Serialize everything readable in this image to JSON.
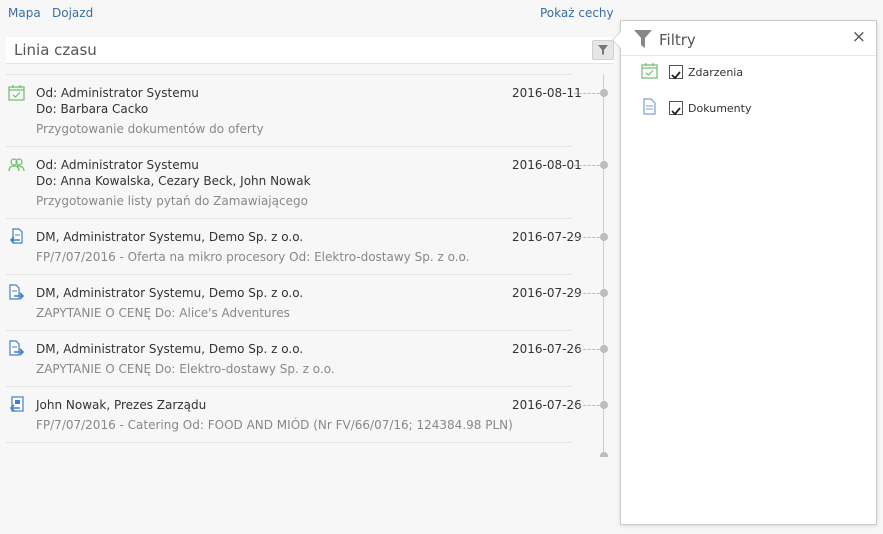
{
  "nav": {
    "map": "Mapa",
    "directions": "Dojazd",
    "show_features": "Pokaż cechy"
  },
  "panel": {
    "title": "Linia czasu"
  },
  "timeline": [
    {
      "icon": "event-calendar-icon",
      "line1": "Od: Administrator Systemu",
      "line2": "Do: Barbara Cacko",
      "sub": "Przygotowanie dokumentów do oferty",
      "date": "2016-08-11"
    },
    {
      "icon": "meeting-people-icon",
      "line1": "Od: Administrator Systemu",
      "line2": "Do: Anna Kowalska, Cezary Beck, John Nowak",
      "sub": "Przygotowanie listy pytań do Zamawiającego",
      "date": "2016-08-01"
    },
    {
      "icon": "incoming-document-icon",
      "line1": "DM, Administrator Systemu, Demo Sp. z o.o.",
      "sub": "FP/7/07/2016 - Oferta na mikro procesory Od: Elektro-dostawy Sp. z o.o.",
      "date": "2016-07-29"
    },
    {
      "icon": "outgoing-document-icon",
      "line1": "DM, Administrator Systemu, Demo Sp. z o.o.",
      "sub": "ZAPYTANIE O CENĘ Do: Alice's Adventures",
      "date": "2016-07-29"
    },
    {
      "icon": "outgoing-document-icon",
      "line1": "DM, Administrator Systemu, Demo Sp. z o.o.",
      "sub": "ZAPYTANIE O CENĘ Do: Elektro-dostawy Sp. z o.o.",
      "date": "2016-07-26"
    },
    {
      "icon": "incoming-invoice-icon",
      "line1": "John Nowak, Prezes Zarządu",
      "sub": "FP/7/07/2016 - Catering Od: FOOD AND MIÓD (Nr FV/66/07/16; 124384.98 PLN)",
      "date": "2016-07-26"
    }
  ],
  "filters": {
    "title": "Filtry",
    "close": "×",
    "options": [
      {
        "label": "Zdarzenia",
        "checked": true,
        "icon": "event-calendar-icon"
      },
      {
        "label": "Dokumenty",
        "checked": true,
        "icon": "document-icon"
      }
    ]
  },
  "colors": {
    "link": "#3a6ea5",
    "event_icon": "#6cbf6c",
    "doc_icon": "#3f7fc9",
    "timeline_dot": "#bdbdbd"
  }
}
